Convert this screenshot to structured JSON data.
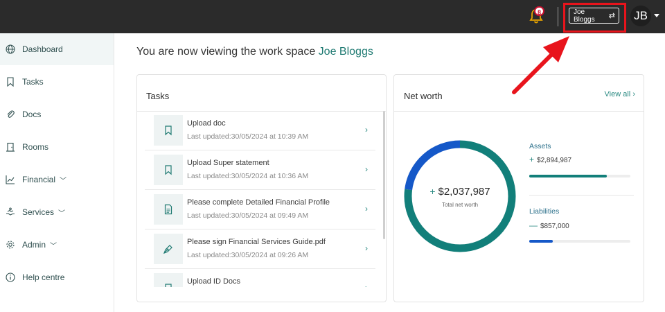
{
  "topbar": {
    "notification_count": "8",
    "workspace_label": "Joe Bloggs",
    "workspace_swap_glyph": "⇄",
    "avatar_initials": "JB"
  },
  "sidebar": {
    "items": [
      {
        "label": "Dashboard",
        "icon": "globe-icon",
        "active": true
      },
      {
        "label": "Tasks",
        "icon": "bookmark-icon"
      },
      {
        "label": "Docs",
        "icon": "paperclip-icon"
      },
      {
        "label": "Rooms",
        "icon": "door-icon"
      },
      {
        "label": "Financial",
        "icon": "chart-icon",
        "expandable": true
      },
      {
        "label": "Services",
        "icon": "handshake-icon",
        "expandable": true
      },
      {
        "label": "Admin",
        "icon": "gear-icon",
        "expandable": true
      },
      {
        "label": "Help centre",
        "icon": "info-icon"
      }
    ]
  },
  "main": {
    "heading_prefix": "You are now viewing the work space ",
    "heading_name": "Joe Bloggs"
  },
  "tasks": {
    "title": "Tasks",
    "items": [
      {
        "title": "Upload doc",
        "updated": "Last updated:30/05/2024 at 10:39 AM",
        "icon": "bookmark-icon"
      },
      {
        "title": "Upload Super statement",
        "updated": "Last updated:30/05/2024 at 10:36 AM",
        "icon": "bookmark-icon"
      },
      {
        "title": "Please complete Detailed Financial Profile",
        "updated": "Last updated:30/05/2024 at 09:49 AM",
        "icon": "document-icon"
      },
      {
        "title": "Please sign Financial Services Guide.pdf",
        "updated": "Last updated:30/05/2024 at 09:26 AM",
        "icon": "pen-icon"
      },
      {
        "title": "Upload ID Docs",
        "updated": "",
        "icon": "bookmark-icon"
      }
    ]
  },
  "networth": {
    "title": "Net worth",
    "view_all": "View all",
    "total_sign": "+",
    "total_value": "$2,037,987",
    "total_label": "Total net worth",
    "assets_label": "Assets",
    "assets_sign": "+",
    "assets_value": "$2,894,987",
    "assets_fraction": 0.77,
    "liabilities_label": "Liabilities",
    "liabilities_sign": "—",
    "liabilities_value": "$857,000",
    "liabilities_fraction": 0.23,
    "colors": {
      "assets": "#127f7a",
      "liabilities": "#1558c8"
    }
  },
  "colors": {
    "accent": "#1f7a72",
    "topbar": "#2b2b2b",
    "annotation": "#e8141c"
  }
}
